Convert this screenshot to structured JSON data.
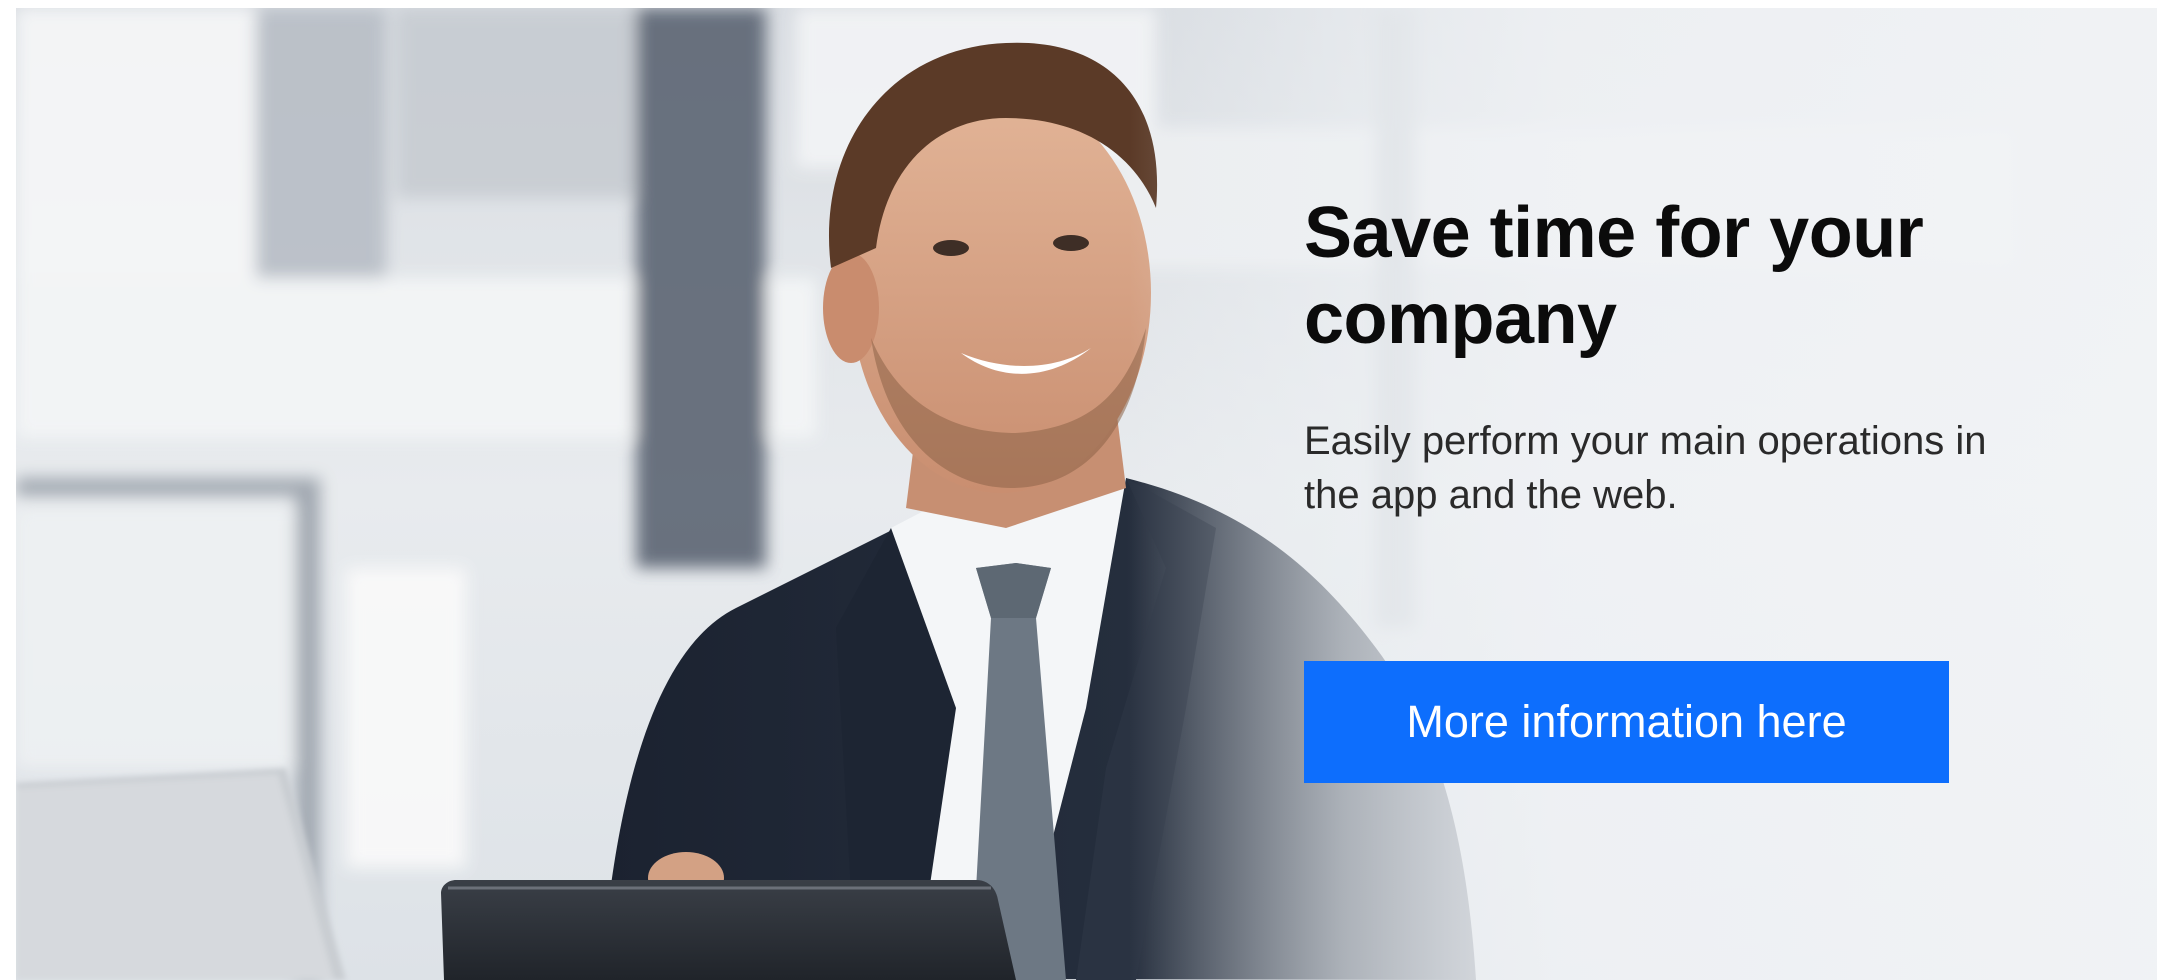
{
  "banner": {
    "headline": "Save time for your company",
    "subtext": "Easily perform your main operations in the app and the web.",
    "cta_label": "More information here"
  },
  "colors": {
    "cta_background": "#0d6efd",
    "cta_text": "#ffffff",
    "headline": "#0b0b0b",
    "subtext": "#2a2a2a"
  },
  "icons": {
    "photo": "businessman-photo"
  }
}
